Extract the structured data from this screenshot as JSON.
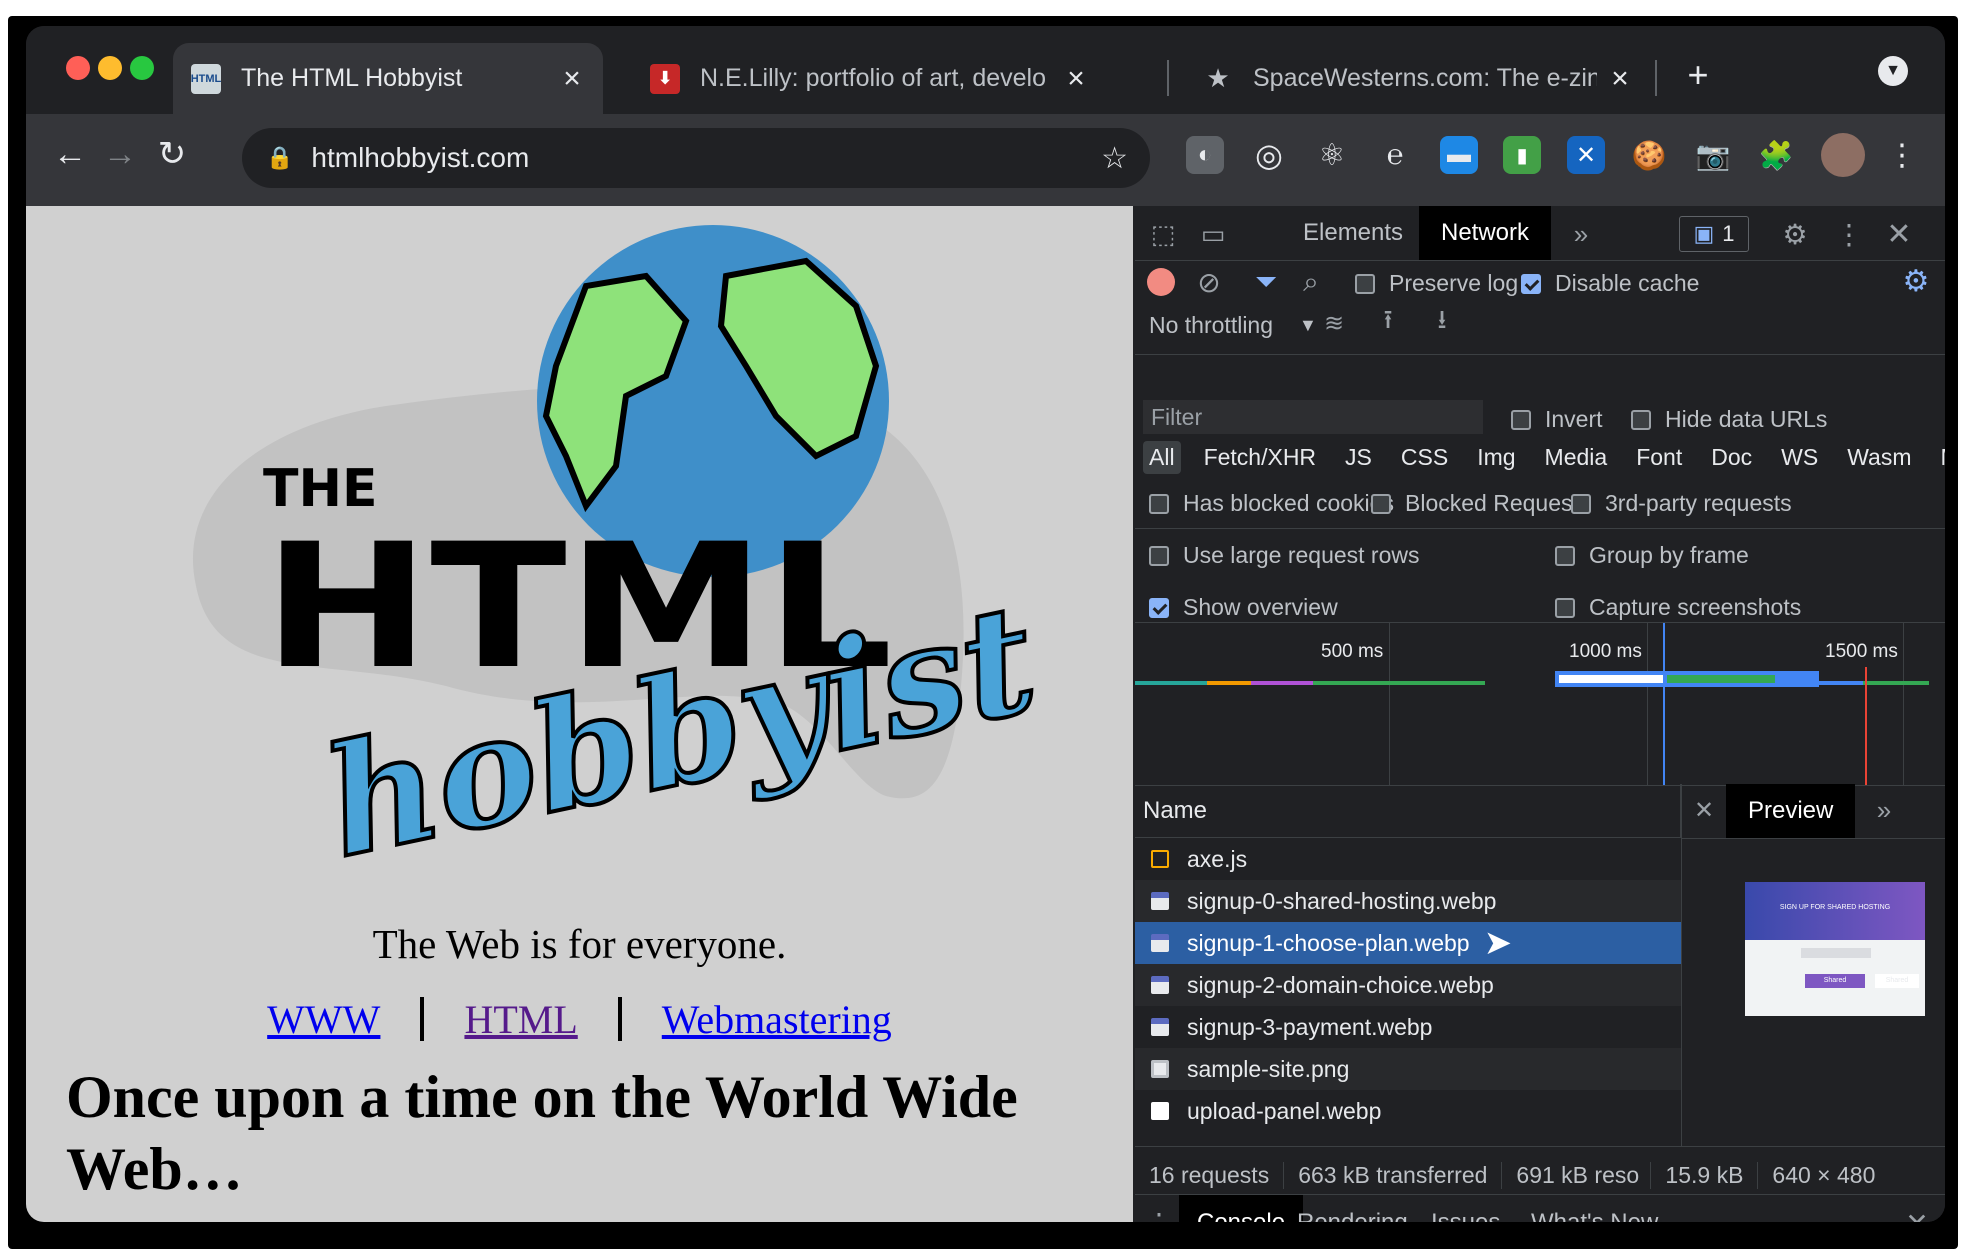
{
  "tabs": [
    {
      "title": "The HTML Hobbyist",
      "favicon": "html-hobbyist-favicon"
    },
    {
      "title": "N.E.Lilly: portfolio of art, develo",
      "favicon": "lilly-favicon"
    },
    {
      "title": "SpaceWesterns.com: The e-zin",
      "favicon": "star-favicon"
    }
  ],
  "omnibox": {
    "url": "htmlhobbyist.com"
  },
  "page": {
    "tagline": "The Web is for everyone.",
    "links": [
      "WWW",
      "HTML",
      "Webmastering"
    ],
    "heading": "Once upon a time on the World Wide Web…",
    "logo": {
      "line1": "THE",
      "line2": "HTML",
      "line3": "hobbyist"
    }
  },
  "devtools": {
    "tabs": [
      "Elements",
      "Network"
    ],
    "messages_badge": "1",
    "preserve_log": "Preserve log",
    "disable_cache": "Disable cache",
    "throttling": "No throttling",
    "filter_placeholder": "Filter",
    "invert": "Invert",
    "hide_data_urls": "Hide data URLs",
    "types": [
      "All",
      "Fetch/XHR",
      "JS",
      "CSS",
      "Img",
      "Media",
      "Font",
      "Doc",
      "WS",
      "Wasm",
      "Manife"
    ],
    "opts_row1": [
      "Has blocked cookies",
      "Blocked Requests",
      "3rd-party requests"
    ],
    "use_large_rows": "Use large request rows",
    "group_by_frame": "Group by frame",
    "show_overview": "Show overview",
    "capture_screenshots": "Capture screenshots",
    "timeline_labels": [
      "500 ms",
      "1000 ms",
      "1500 ms"
    ],
    "name_header": "Name",
    "preview_tab": "Preview",
    "requests": [
      {
        "name": "axe.js",
        "kind": "script"
      },
      {
        "name": "signup-0-shared-hosting.webp",
        "kind": "image"
      },
      {
        "name": "signup-1-choose-plan.webp",
        "kind": "image"
      },
      {
        "name": "signup-2-domain-choice.webp",
        "kind": "image"
      },
      {
        "name": "signup-3-payment.webp",
        "kind": "image"
      },
      {
        "name": "sample-site.png",
        "kind": "image"
      },
      {
        "name": "upload-panel.webp",
        "kind": "image"
      }
    ],
    "summary": [
      "16 requests",
      "663 kB transferred",
      "691 kB reso",
      "15.9 kB",
      "640 × 480"
    ],
    "drawer_tabs": [
      "Console",
      "Rendering",
      "Issues",
      "What's New"
    ],
    "preview_img": {
      "line1": "SIGN UP FOR SHARED HOSTING",
      "shared": "Shared",
      "shared2": "Shared"
    }
  }
}
